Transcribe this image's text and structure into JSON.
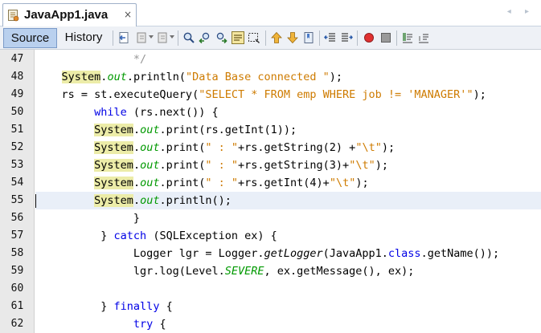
{
  "editor": {
    "file_tab": {
      "title": "JavaApp1.java",
      "close_glyph": "×",
      "icon": "java-file-icon"
    },
    "nav_arrows": "◂ ▸",
    "view_buttons": {
      "source": "Source",
      "history": "History"
    },
    "active_view": "Source",
    "toolbar_icons": [
      "last-edit-icon",
      "back-icon",
      "forward-icon",
      "find-selection-icon",
      "find-previous-icon",
      "find-next-icon",
      "toggle-highlight-icon",
      "toggle-rect-selection-icon",
      "previous-bookmark-icon",
      "next-bookmark-icon",
      "toggle-bookmark-icon",
      "shift-left-icon",
      "shift-right-icon",
      "start-macro-recording-icon",
      "stop-macro-recording-icon",
      "comment-icon",
      "uncomment-icon"
    ],
    "current_line": 55,
    "lines": [
      {
        "number": "47",
        "tokens": [
          {
            "text": "               */",
            "type": "comment"
          }
        ]
      },
      {
        "number": "48",
        "tokens": [
          {
            "text": "    ",
            "type": "plain"
          },
          {
            "text": "System",
            "type": "system"
          },
          {
            "text": ".",
            "type": "plain"
          },
          {
            "text": "out",
            "type": "field"
          },
          {
            "text": ".println(",
            "type": "plain"
          },
          {
            "text": "\"Data Base connected \"",
            "type": "string"
          },
          {
            "text": ");",
            "type": "plain"
          }
        ]
      },
      {
        "number": "49",
        "tokens": [
          {
            "text": "    rs = st.executeQuery(",
            "type": "plain"
          },
          {
            "text": "\"SELECT * FROM emp WHERE job != 'MANAGER'\"",
            "type": "string"
          },
          {
            "text": ");",
            "type": "plain"
          }
        ]
      },
      {
        "number": "50",
        "tokens": [
          {
            "text": "         ",
            "type": "plain"
          },
          {
            "text": "while",
            "type": "keyword"
          },
          {
            "text": " (rs.next()) {",
            "type": "plain"
          }
        ]
      },
      {
        "number": "51",
        "tokens": [
          {
            "text": "         ",
            "type": "plain"
          },
          {
            "text": "System",
            "type": "system"
          },
          {
            "text": ".",
            "type": "plain"
          },
          {
            "text": "out",
            "type": "field"
          },
          {
            "text": ".print(rs.getInt(1));",
            "type": "plain"
          }
        ]
      },
      {
        "number": "52",
        "tokens": [
          {
            "text": "         ",
            "type": "plain"
          },
          {
            "text": "System",
            "type": "system"
          },
          {
            "text": ".",
            "type": "plain"
          },
          {
            "text": "out",
            "type": "field"
          },
          {
            "text": ".print(",
            "type": "plain"
          },
          {
            "text": "\" : \"",
            "type": "string"
          },
          {
            "text": "+rs.getString(2) +",
            "type": "plain"
          },
          {
            "text": "\"\\t\"",
            "type": "string"
          },
          {
            "text": ");",
            "type": "plain"
          }
        ]
      },
      {
        "number": "53",
        "tokens": [
          {
            "text": "         ",
            "type": "plain"
          },
          {
            "text": "System",
            "type": "system"
          },
          {
            "text": ".",
            "type": "plain"
          },
          {
            "text": "out",
            "type": "field"
          },
          {
            "text": ".print(",
            "type": "plain"
          },
          {
            "text": "\" : \"",
            "type": "string"
          },
          {
            "text": "+rs.getString(3)+",
            "type": "plain"
          },
          {
            "text": "\"\\t\"",
            "type": "string"
          },
          {
            "text": ");",
            "type": "plain"
          }
        ]
      },
      {
        "number": "54",
        "tokens": [
          {
            "text": "         ",
            "type": "plain"
          },
          {
            "text": "System",
            "type": "system"
          },
          {
            "text": ".",
            "type": "plain"
          },
          {
            "text": "out",
            "type": "field"
          },
          {
            "text": ".print(",
            "type": "plain"
          },
          {
            "text": "\" : \"",
            "type": "string"
          },
          {
            "text": "+rs.getInt(4)+",
            "type": "plain"
          },
          {
            "text": "\"\\t\"",
            "type": "string"
          },
          {
            "text": ");",
            "type": "plain"
          }
        ]
      },
      {
        "number": "55",
        "tokens": [
          {
            "text": "         ",
            "type": "plain"
          },
          {
            "text": "System",
            "type": "system"
          },
          {
            "text": ".",
            "type": "plain"
          },
          {
            "text": "out",
            "type": "field"
          },
          {
            "text": ".println();",
            "type": "plain"
          }
        ]
      },
      {
        "number": "56",
        "tokens": [
          {
            "text": "               }",
            "type": "plain"
          }
        ]
      },
      {
        "number": "57",
        "tokens": [
          {
            "text": "          } ",
            "type": "plain"
          },
          {
            "text": "catch",
            "type": "keyword"
          },
          {
            "text": " (SQLException ex) {",
            "type": "plain"
          }
        ]
      },
      {
        "number": "58",
        "tokens": [
          {
            "text": "               Logger lgr = Logger.",
            "type": "plain"
          },
          {
            "text": "getLogger",
            "type": "italic"
          },
          {
            "text": "(JavaApp1.",
            "type": "plain"
          },
          {
            "text": "class",
            "type": "keyword"
          },
          {
            "text": ".getName());",
            "type": "plain"
          }
        ]
      },
      {
        "number": "59",
        "tokens": [
          {
            "text": "               lgr.log(Level.",
            "type": "plain"
          },
          {
            "text": "SEVERE",
            "type": "field"
          },
          {
            "text": ", ex.getMessage(), ex);",
            "type": "plain"
          }
        ]
      },
      {
        "number": "60",
        "tokens": []
      },
      {
        "number": "61",
        "tokens": [
          {
            "text": "          } ",
            "type": "plain"
          },
          {
            "text": "finally",
            "type": "keyword"
          },
          {
            "text": " {",
            "type": "plain"
          }
        ]
      },
      {
        "number": "62",
        "tokens": [
          {
            "text": "               ",
            "type": "plain"
          },
          {
            "text": "try",
            "type": "keyword"
          },
          {
            "text": " {",
            "type": "plain"
          }
        ]
      }
    ]
  }
}
